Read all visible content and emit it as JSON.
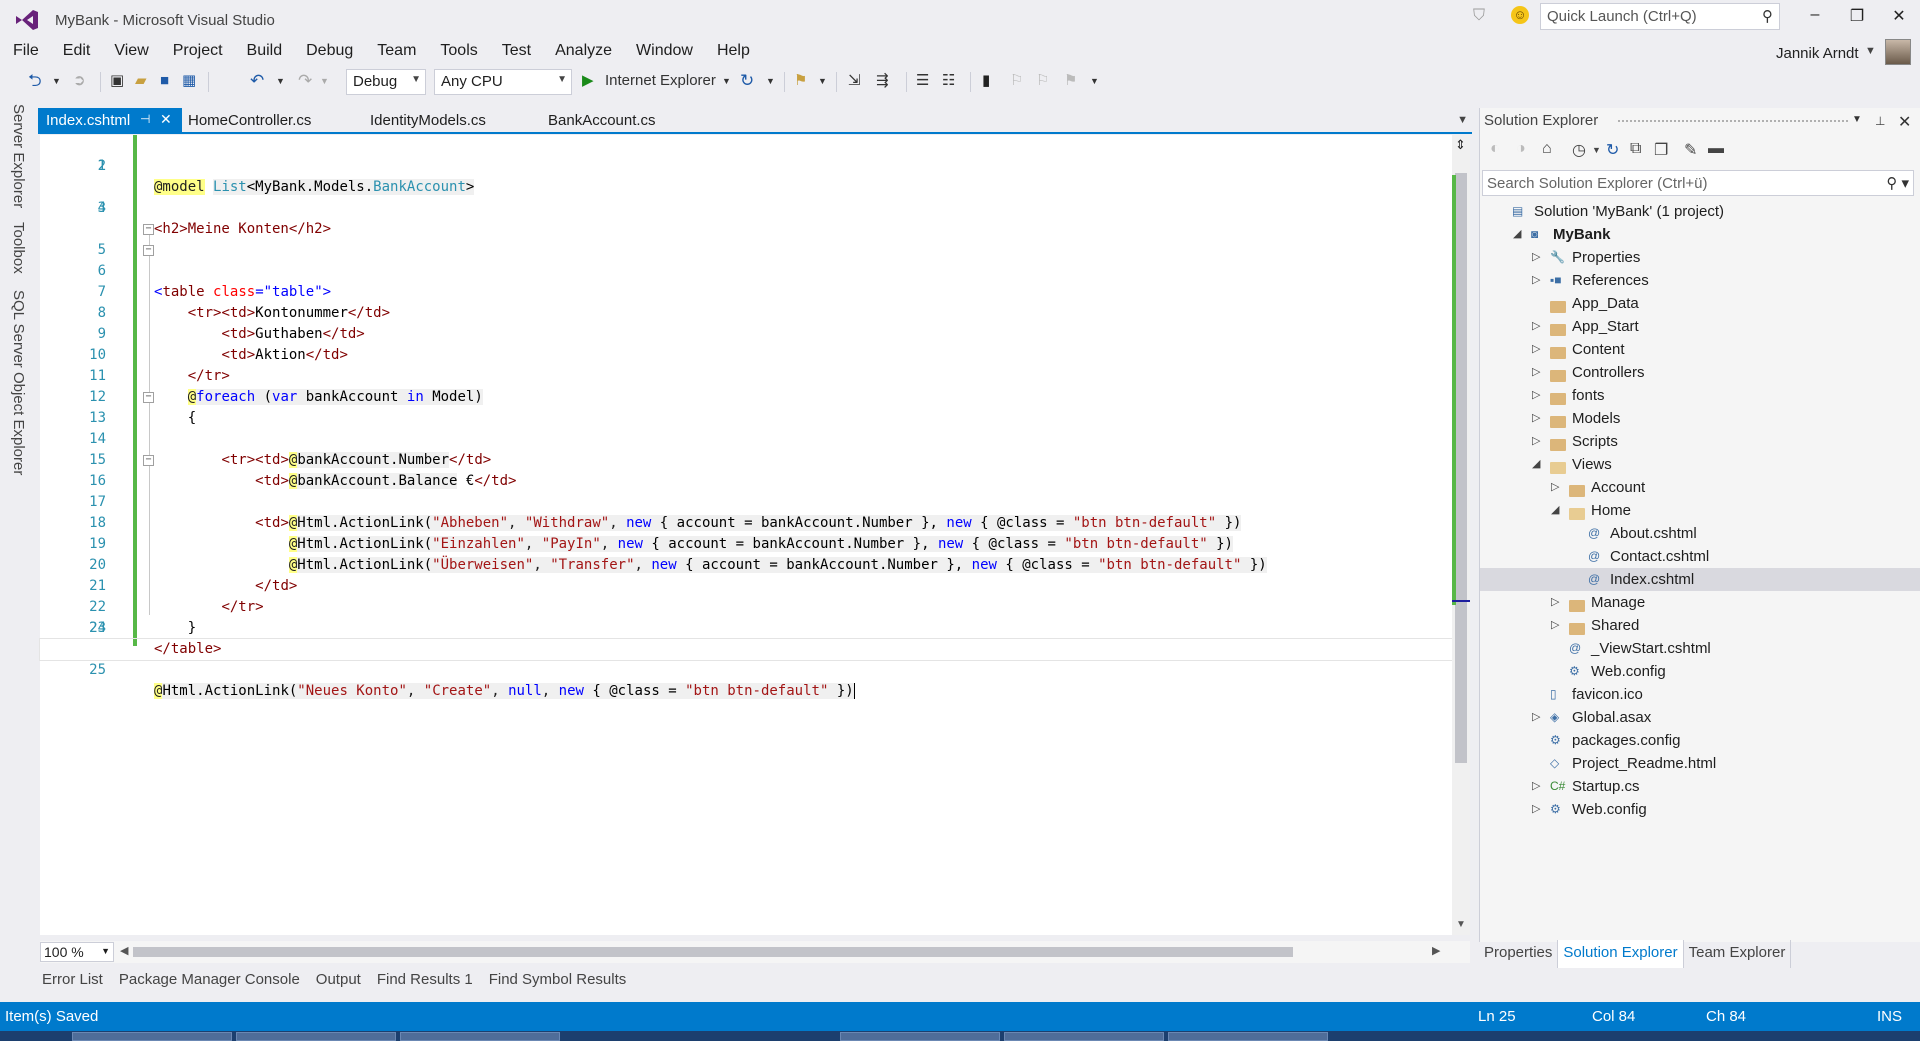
{
  "window": {
    "title": "MyBank - Microsoft Visual Studio",
    "quick_launch_placeholder": "Quick Launch (Ctrl+Q)",
    "user": "Jannik Arndt",
    "minimize": "–",
    "restore": "❐",
    "close": "✕"
  },
  "menu": [
    "File",
    "Edit",
    "View",
    "Project",
    "Build",
    "Debug",
    "Team",
    "Tools",
    "Test",
    "Analyze",
    "Window",
    "Help"
  ],
  "toolbar": {
    "config": "Debug",
    "platform": "Any CPU",
    "run_target": "Internet Explorer"
  },
  "left_tabs": [
    "Server Explorer",
    "Toolbox",
    "SQL Server Object Explorer"
  ],
  "editor_tabs": [
    {
      "label": "Index.cshtml",
      "active": true
    },
    {
      "label": "HomeController.cs"
    },
    {
      "label": "IdentityModels.cs"
    },
    {
      "label": "BankAccount.cs"
    }
  ],
  "code_lines": [
    "1",
    "2",
    "3",
    "4",
    "5",
    "6",
    "7",
    "8",
    "9",
    "10",
    "11",
    "12",
    "13",
    "14",
    "15",
    "16",
    "17",
    "18",
    "19",
    "20",
    "21",
    "22",
    "23",
    "24",
    "25"
  ],
  "code": {
    "l1_model": "@model",
    "l1_list": "List",
    "l1_ns": "<MyBank.Models.",
    "l1_type": "BankAccount",
    "l1_end": ">",
    "l3": "<h2>Meine Konten</h2>",
    "l5_open": "<table",
    "l5_attr": "class",
    "l5_eq": "=",
    "l5_val": "\"table\"",
    "l5_close": ">",
    "l6": "<tr>",
    "l7": "Kontonummer",
    "l8": "Guthaben",
    "l9": "Aktion",
    "l10": "</tr>",
    "l11_at": "@",
    "l11_foreach": "foreach",
    "l11_paren": " (",
    "l11_var": "var",
    "l11_mid": " bankAccount ",
    "l11_in": "in",
    "l11_end": " Model)",
    "l12": "{",
    "l13": "<tr>",
    "l14_expr": "bankAccount.Number",
    "l15_expr": "bankAccount.Balance",
    "l15_text": " €",
    "l16": "<td>",
    "l17": [
      "Abheben",
      "Withdraw"
    ],
    "l18": [
      "Einzahlen",
      "PayIn"
    ],
    "l19": [
      "Überweisen",
      "Transfer"
    ],
    "l20": "</td>",
    "l21": "</tr>",
    "l22": "}",
    "l23": "</table>",
    "l25": [
      "Neues Konto",
      "Create"
    ],
    "btn_class": "\"btn btn-default\"",
    "html_action": "Html.ActionLink(",
    "account_arg": " { account = bankAccount.Number }, ",
    "new_kw": "new",
    "null_kw": "null",
    "class_open": " { @class = ",
    "close": " })"
  },
  "zoom": "100 %",
  "bottom_tabs": [
    "Error List",
    "Package Manager Console",
    "Output",
    "Find Results 1",
    "Find Symbol Results"
  ],
  "solution_explorer": {
    "title": "Solution Explorer",
    "search_placeholder": "Search Solution Explorer (Ctrl+ü)",
    "tree": [
      {
        "label": "Solution 'MyBank' (1 project)",
        "depth": 0,
        "expander": "",
        "icon": "solution-icon"
      },
      {
        "label": "MyBank",
        "depth": 1,
        "expander": "◢",
        "icon": "project-icon",
        "bold": true
      },
      {
        "label": "Properties",
        "depth": 2,
        "expander": "▷",
        "icon": "wrench-icon"
      },
      {
        "label": "References",
        "depth": 2,
        "expander": "▷",
        "icon": "references-icon"
      },
      {
        "label": "App_Data",
        "depth": 2,
        "expander": "",
        "icon": "folder-icon"
      },
      {
        "label": "App_Start",
        "depth": 2,
        "expander": "▷",
        "icon": "folder-icon"
      },
      {
        "label": "Content",
        "depth": 2,
        "expander": "▷",
        "icon": "folder-icon"
      },
      {
        "label": "Controllers",
        "depth": 2,
        "expander": "▷",
        "icon": "folder-icon"
      },
      {
        "label": "fonts",
        "depth": 2,
        "expander": "▷",
        "icon": "folder-icon"
      },
      {
        "label": "Models",
        "depth": 2,
        "expander": "▷",
        "icon": "folder-icon"
      },
      {
        "label": "Scripts",
        "depth": 2,
        "expander": "▷",
        "icon": "folder-icon"
      },
      {
        "label": "Views",
        "depth": 2,
        "expander": "◢",
        "icon": "folder-open-icon"
      },
      {
        "label": "Account",
        "depth": 3,
        "expander": "▷",
        "icon": "folder-icon"
      },
      {
        "label": "Home",
        "depth": 3,
        "expander": "◢",
        "icon": "folder-open-icon"
      },
      {
        "label": "About.cshtml",
        "depth": 4,
        "expander": "",
        "icon": "razor-file-icon"
      },
      {
        "label": "Contact.cshtml",
        "depth": 4,
        "expander": "",
        "icon": "razor-file-icon"
      },
      {
        "label": "Index.cshtml",
        "depth": 4,
        "expander": "",
        "icon": "razor-file-icon",
        "selected": true
      },
      {
        "label": "Manage",
        "depth": 3,
        "expander": "▷",
        "icon": "folder-icon"
      },
      {
        "label": "Shared",
        "depth": 3,
        "expander": "▷",
        "icon": "folder-icon"
      },
      {
        "label": "_ViewStart.cshtml",
        "depth": 3,
        "expander": "",
        "icon": "razor-file-icon"
      },
      {
        "label": "Web.config",
        "depth": 3,
        "expander": "",
        "icon": "config-file-icon"
      },
      {
        "label": "favicon.ico",
        "depth": 2,
        "expander": "",
        "icon": "file-icon"
      },
      {
        "label": "Global.asax",
        "depth": 2,
        "expander": "▷",
        "icon": "global-file-icon"
      },
      {
        "label": "packages.config",
        "depth": 2,
        "expander": "",
        "icon": "config-file-icon"
      },
      {
        "label": "Project_Readme.html",
        "depth": 2,
        "expander": "",
        "icon": "html-file-icon"
      },
      {
        "label": "Startup.cs",
        "depth": 2,
        "expander": "▷",
        "icon": "csharp-file-icon"
      },
      {
        "label": "Web.config",
        "depth": 2,
        "expander": "▷",
        "icon": "config-file-icon"
      }
    ],
    "bottom_tabs": [
      "Properties",
      "Solution Explorer",
      "Team Explorer"
    ]
  },
  "status": {
    "message": "Item(s) Saved",
    "ln": "Ln 25",
    "col": "Col 84",
    "ch": "Ch 84",
    "mode": "INS"
  },
  "colors": {
    "accent": "#007acc",
    "change_bar": "#57b847",
    "razor_highlight": "#ffff88"
  }
}
